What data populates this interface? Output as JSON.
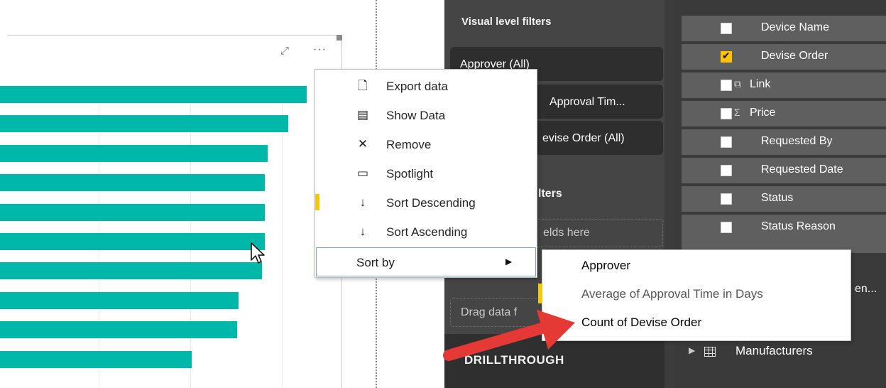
{
  "chart": {
    "bar_color": "#00b8aa",
    "bars": [
      {
        "value": 100
      },
      {
        "value": 93.9
      },
      {
        "value": 87.2
      },
      {
        "value": 86.3
      },
      {
        "value": 86.3
      },
      {
        "value": 86.3
      },
      {
        "value": 85.4
      },
      {
        "value": 77.8
      },
      {
        "value": 77.4
      },
      {
        "value": 62.6
      }
    ]
  },
  "visual_header": {
    "focus_icon": "focus-mode-icon",
    "more_icon": "ellipsis-icon"
  },
  "context_menu": {
    "items": [
      {
        "icon": "export-data-icon",
        "glyph": "🗋",
        "label": "Export data"
      },
      {
        "icon": "show-data-icon",
        "glyph": "▤",
        "label": "Show Data"
      },
      {
        "icon": "remove-icon",
        "glyph": "✕",
        "label": "Remove"
      },
      {
        "icon": "spotlight-icon",
        "glyph": "▭",
        "label": "Spotlight"
      },
      {
        "icon": "sort-descending-icon",
        "glyph": "↓",
        "label": "Sort Descending"
      },
      {
        "icon": "sort-ascending-icon",
        "glyph": "↓",
        "label": "Sort Ascending"
      }
    ],
    "sort_by_label": "Sort by"
  },
  "sort_submenu": {
    "items": [
      {
        "label": "Approver",
        "color": "#252525"
      },
      {
        "label": "Average of Approval Time in Days",
        "color": "#555555"
      },
      {
        "label": "Count of Devise Order",
        "color": "#252525"
      }
    ]
  },
  "filters_pane": {
    "visual_filters_heading": "Visual level filters",
    "cards": [
      {
        "label": "Approver  (All)"
      },
      {
        "label": "Approval Tim..."
      },
      {
        "label": "evise Order  (All)"
      }
    ],
    "page_filters_heading_partial": "lters",
    "page_dropzone_partial": "elds here",
    "drillthrough_dropzone_partial": "Drag data f",
    "drillthrough_heading": "DRILLTHROUGH"
  },
  "fields_pane": {
    "rows": [
      {
        "label": "Device Name",
        "checked": false,
        "type_icon": ""
      },
      {
        "label": "Devise Order",
        "checked": true,
        "type_icon": ""
      },
      {
        "label": "Link",
        "checked": false,
        "type_icon": "link-icon"
      },
      {
        "label": "Price",
        "checked": false,
        "type_icon": "sigma-icon"
      },
      {
        "label": "Requested By",
        "checked": false,
        "type_icon": ""
      },
      {
        "label": "Requested Date",
        "checked": false,
        "type_icon": ""
      },
      {
        "label": "Status",
        "checked": false,
        "type_icon": ""
      },
      {
        "label": "Status Reason",
        "checked": false,
        "type_icon": ""
      }
    ],
    "partial_row_right": "en...",
    "table_label": "Manufacturers"
  },
  "colors": {
    "accent_yellow": "#f2c811",
    "arrow_red": "#e53935",
    "pane_dark": "#454545",
    "fields_dark": "#3a3a3a"
  }
}
